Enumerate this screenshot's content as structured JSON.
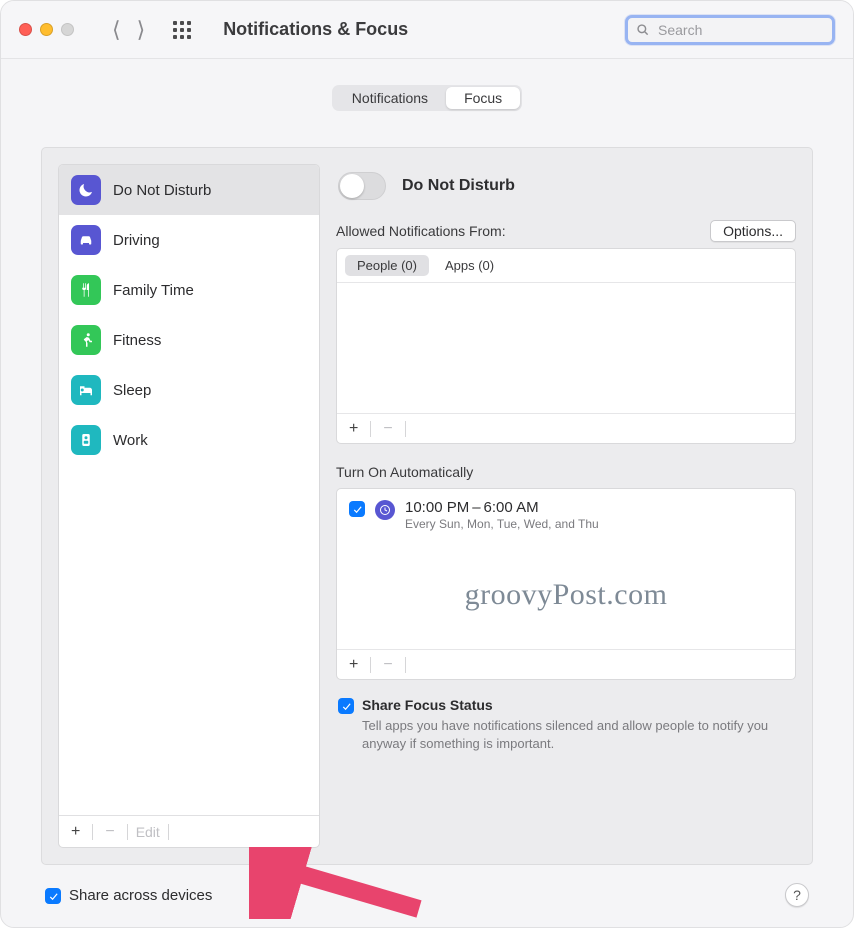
{
  "window_title": "Notifications & Focus",
  "search": {
    "placeholder": "Search",
    "value": ""
  },
  "tabs": {
    "notifications": "Notifications",
    "focus": "Focus"
  },
  "focus_modes": [
    {
      "key": "dnd",
      "label": "Do Not Disturb",
      "color": "#5856d2",
      "icon": "moon"
    },
    {
      "key": "driving",
      "label": "Driving",
      "color": "#5856d2",
      "icon": "car"
    },
    {
      "key": "family",
      "label": "Family Time",
      "color": "#33c758",
      "icon": "fork"
    },
    {
      "key": "fitness",
      "label": "Fitness",
      "color": "#33c758",
      "icon": "run"
    },
    {
      "key": "sleep",
      "label": "Sleep",
      "color": "#1fb8bf",
      "icon": "bed"
    },
    {
      "key": "work",
      "label": "Work",
      "color": "#1fb8bf",
      "icon": "badge"
    }
  ],
  "selected_focus_index": 0,
  "sidebar_footer": {
    "add": "+",
    "remove": "−",
    "edit": "Edit"
  },
  "detail": {
    "toggle_label": "Do Not Disturb",
    "allowed_label": "Allowed Notifications From:",
    "options_button": "Options...",
    "allowed_tabs": {
      "people": "People (0)",
      "apps": "Apps (0)"
    },
    "auto_label": "Turn On Automatically",
    "schedule": {
      "time_range": "10:00 PM – 6:00 AM",
      "days": "Every Sun, Mon, Tue, Wed, and Thu"
    },
    "share_status": {
      "title": "Share Focus Status",
      "desc": "Tell apps you have notifications silenced and allow people to notify you anyway if something is important."
    }
  },
  "share_across_devices": "Share across devices",
  "watermark": "groovyPost.com"
}
